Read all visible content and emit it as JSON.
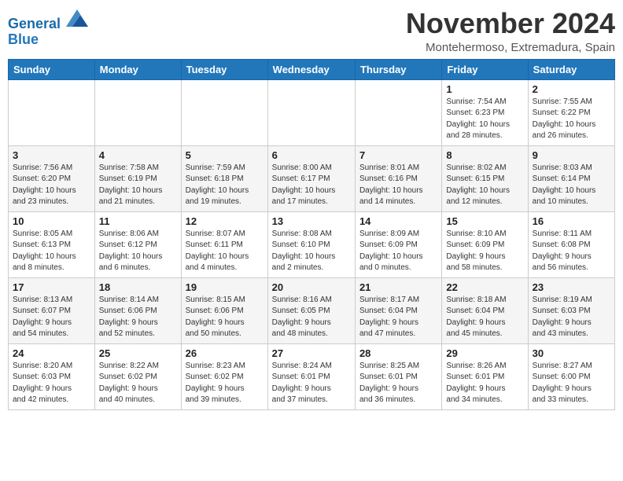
{
  "header": {
    "logo_line1": "General",
    "logo_line2": "Blue",
    "month": "November 2024",
    "location": "Montehermoso, Extremadura, Spain"
  },
  "weekdays": [
    "Sunday",
    "Monday",
    "Tuesday",
    "Wednesday",
    "Thursday",
    "Friday",
    "Saturday"
  ],
  "weeks": [
    [
      {
        "day": "",
        "info": ""
      },
      {
        "day": "",
        "info": ""
      },
      {
        "day": "",
        "info": ""
      },
      {
        "day": "",
        "info": ""
      },
      {
        "day": "",
        "info": ""
      },
      {
        "day": "1",
        "info": "Sunrise: 7:54 AM\nSunset: 6:23 PM\nDaylight: 10 hours\nand 28 minutes."
      },
      {
        "day": "2",
        "info": "Sunrise: 7:55 AM\nSunset: 6:22 PM\nDaylight: 10 hours\nand 26 minutes."
      }
    ],
    [
      {
        "day": "3",
        "info": "Sunrise: 7:56 AM\nSunset: 6:20 PM\nDaylight: 10 hours\nand 23 minutes."
      },
      {
        "day": "4",
        "info": "Sunrise: 7:58 AM\nSunset: 6:19 PM\nDaylight: 10 hours\nand 21 minutes."
      },
      {
        "day": "5",
        "info": "Sunrise: 7:59 AM\nSunset: 6:18 PM\nDaylight: 10 hours\nand 19 minutes."
      },
      {
        "day": "6",
        "info": "Sunrise: 8:00 AM\nSunset: 6:17 PM\nDaylight: 10 hours\nand 17 minutes."
      },
      {
        "day": "7",
        "info": "Sunrise: 8:01 AM\nSunset: 6:16 PM\nDaylight: 10 hours\nand 14 minutes."
      },
      {
        "day": "8",
        "info": "Sunrise: 8:02 AM\nSunset: 6:15 PM\nDaylight: 10 hours\nand 12 minutes."
      },
      {
        "day": "9",
        "info": "Sunrise: 8:03 AM\nSunset: 6:14 PM\nDaylight: 10 hours\nand 10 minutes."
      }
    ],
    [
      {
        "day": "10",
        "info": "Sunrise: 8:05 AM\nSunset: 6:13 PM\nDaylight: 10 hours\nand 8 minutes."
      },
      {
        "day": "11",
        "info": "Sunrise: 8:06 AM\nSunset: 6:12 PM\nDaylight: 10 hours\nand 6 minutes."
      },
      {
        "day": "12",
        "info": "Sunrise: 8:07 AM\nSunset: 6:11 PM\nDaylight: 10 hours\nand 4 minutes."
      },
      {
        "day": "13",
        "info": "Sunrise: 8:08 AM\nSunset: 6:10 PM\nDaylight: 10 hours\nand 2 minutes."
      },
      {
        "day": "14",
        "info": "Sunrise: 8:09 AM\nSunset: 6:09 PM\nDaylight: 10 hours\nand 0 minutes."
      },
      {
        "day": "15",
        "info": "Sunrise: 8:10 AM\nSunset: 6:09 PM\nDaylight: 9 hours\nand 58 minutes."
      },
      {
        "day": "16",
        "info": "Sunrise: 8:11 AM\nSunset: 6:08 PM\nDaylight: 9 hours\nand 56 minutes."
      }
    ],
    [
      {
        "day": "17",
        "info": "Sunrise: 8:13 AM\nSunset: 6:07 PM\nDaylight: 9 hours\nand 54 minutes."
      },
      {
        "day": "18",
        "info": "Sunrise: 8:14 AM\nSunset: 6:06 PM\nDaylight: 9 hours\nand 52 minutes."
      },
      {
        "day": "19",
        "info": "Sunrise: 8:15 AM\nSunset: 6:06 PM\nDaylight: 9 hours\nand 50 minutes."
      },
      {
        "day": "20",
        "info": "Sunrise: 8:16 AM\nSunset: 6:05 PM\nDaylight: 9 hours\nand 48 minutes."
      },
      {
        "day": "21",
        "info": "Sunrise: 8:17 AM\nSunset: 6:04 PM\nDaylight: 9 hours\nand 47 minutes."
      },
      {
        "day": "22",
        "info": "Sunrise: 8:18 AM\nSunset: 6:04 PM\nDaylight: 9 hours\nand 45 minutes."
      },
      {
        "day": "23",
        "info": "Sunrise: 8:19 AM\nSunset: 6:03 PM\nDaylight: 9 hours\nand 43 minutes."
      }
    ],
    [
      {
        "day": "24",
        "info": "Sunrise: 8:20 AM\nSunset: 6:03 PM\nDaylight: 9 hours\nand 42 minutes."
      },
      {
        "day": "25",
        "info": "Sunrise: 8:22 AM\nSunset: 6:02 PM\nDaylight: 9 hours\nand 40 minutes."
      },
      {
        "day": "26",
        "info": "Sunrise: 8:23 AM\nSunset: 6:02 PM\nDaylight: 9 hours\nand 39 minutes."
      },
      {
        "day": "27",
        "info": "Sunrise: 8:24 AM\nSunset: 6:01 PM\nDaylight: 9 hours\nand 37 minutes."
      },
      {
        "day": "28",
        "info": "Sunrise: 8:25 AM\nSunset: 6:01 PM\nDaylight: 9 hours\nand 36 minutes."
      },
      {
        "day": "29",
        "info": "Sunrise: 8:26 AM\nSunset: 6:01 PM\nDaylight: 9 hours\nand 34 minutes."
      },
      {
        "day": "30",
        "info": "Sunrise: 8:27 AM\nSunset: 6:00 PM\nDaylight: 9 hours\nand 33 minutes."
      }
    ]
  ]
}
